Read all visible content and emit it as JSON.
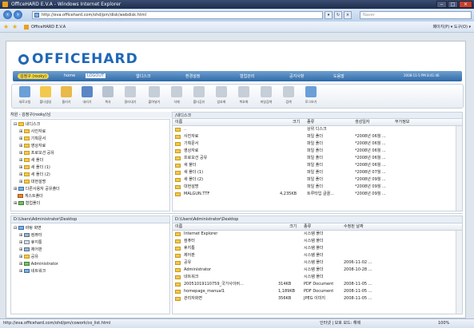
{
  "window": {
    "title": "OfficeHARD E.V.A - Windows Internet Explorer"
  },
  "address": {
    "url": "http://eva.officehard.com/ohd/pm/disk/webdisk.html",
    "search_placeholder": "Naver"
  },
  "favorites": {
    "tab": "OfficeHARD E.V.A",
    "commands": "페이지(P) ▾  도구(O) ▾"
  },
  "logo": {
    "text": "OFFICEHARD"
  },
  "menu": {
    "user": "김정구 (rooky)",
    "items": [
      "home",
      "LOGOUT",
      "웹디스크",
      "환경설정",
      "협업관리",
      "공지사항",
      "도움말"
    ],
    "datetime": "2008-11-5 PM 8:41:46"
  },
  "toolbar": {
    "labels": [
      "새로고침",
      "폴더생성",
      "올리기",
      "내리기",
      "복사",
      "잘라내기",
      "붙여넣기",
      "삭제",
      "폴더공유",
      "암호화",
      "복호화",
      "파일검색",
      "검색",
      "로그보기"
    ]
  },
  "remote": {
    "path": "자원 - 김정구(rooky)님",
    "tree": [
      "내디스크",
      "사진자료",
      "기획문서",
      "영상자료",
      "프로모션 공유",
      "새 폴더",
      "새 폴더 (1)",
      "새 폴더 (2)",
      "대현설명",
      "다른사용자 공유폴더",
      "게스트폴더",
      "협업폴더"
    ],
    "folder_path": "/내디스크",
    "columns": {
      "name": "이름",
      "size": "크기",
      "type": "종류",
      "date": "생성일자",
      "extra": "부가정보"
    },
    "rows": [
      {
        "name": "..",
        "size": "",
        "type": "상위 디스크",
        "date": ""
      },
      {
        "name": "사진자료",
        "size": "",
        "type": "파일 폴더",
        "date": "*2008년 06월 ..."
      },
      {
        "name": "기획문서",
        "size": "",
        "type": "파일 폴더",
        "date": "*2008년 06월 ..."
      },
      {
        "name": "영상자료",
        "size": "",
        "type": "파일 폴더",
        "date": "*2008년 06월 ..."
      },
      {
        "name": "프로모션 공유",
        "size": "",
        "type": "파일 폴더",
        "date": "*2008년 06월 ..."
      },
      {
        "name": "새 폴더",
        "size": "",
        "type": "파일 폴더",
        "date": "*2008년 06월 ..."
      },
      {
        "name": "새 폴더 (1)",
        "size": "",
        "type": "파일 폴더",
        "date": "*2008년 07월 ..."
      },
      {
        "name": "새 폴더 (2)",
        "size": "",
        "type": "파일 폴더",
        "date": "*2008년 09월 ..."
      },
      {
        "name": "대현설명",
        "size": "",
        "type": "파일 폴더",
        "date": "*2008년 09월 ..."
      },
      {
        "name": "MALGUN.TTF",
        "size": "4,235KB",
        "type": "트루타입 글꼴...",
        "date": "*2008년 09월 ..."
      }
    ]
  },
  "local": {
    "path": "D:\\Users\\Administrator\\Desktop",
    "tree": [
      "바탕 화면",
      "컴퓨터",
      "휴지통",
      "제어판",
      "공유",
      "Administrator",
      "네트워크"
    ],
    "columns": {
      "name": "이름",
      "size": "크기",
      "type": "종류",
      "date": "수정된 날짜"
    },
    "rows": [
      {
        "name": "Internet Explorer",
        "size": "",
        "type": "시스템 폴더",
        "date": ""
      },
      {
        "name": "컴퓨터",
        "size": "",
        "type": "시스템 폴더",
        "date": ""
      },
      {
        "name": "휴지통",
        "size": "",
        "type": "시스템 폴더",
        "date": ""
      },
      {
        "name": "제어판",
        "size": "",
        "type": "시스템 폴더",
        "date": ""
      },
      {
        "name": "공유",
        "size": "",
        "type": "시스템 폴더",
        "date": "2006-11-02 ..."
      },
      {
        "name": "Administrator",
        "size": "",
        "type": "시스템 폴더",
        "date": "2008-10-28 ..."
      },
      {
        "name": "네트워크",
        "size": "",
        "type": "시스템 폴더",
        "date": ""
      },
      {
        "name": "20051019110759_국가사이버...",
        "size": "314KB",
        "type": "PDF Document",
        "date": "2008-11-05 ..."
      },
      {
        "name": "homepage_manual1",
        "size": "1,189KB",
        "type": "PDF Document",
        "date": "2008-11-05 ..."
      },
      {
        "name": "관리자화면",
        "size": "356KB",
        "type": "JPEG 이미지",
        "date": "2008-11-05 ..."
      }
    ]
  },
  "status": {
    "url": "http://eva.officehard.com/ohd/pm/cowork/co_list.html",
    "zone": "인터넷 | 보호 모드: 해제",
    "zoom": "100%"
  }
}
